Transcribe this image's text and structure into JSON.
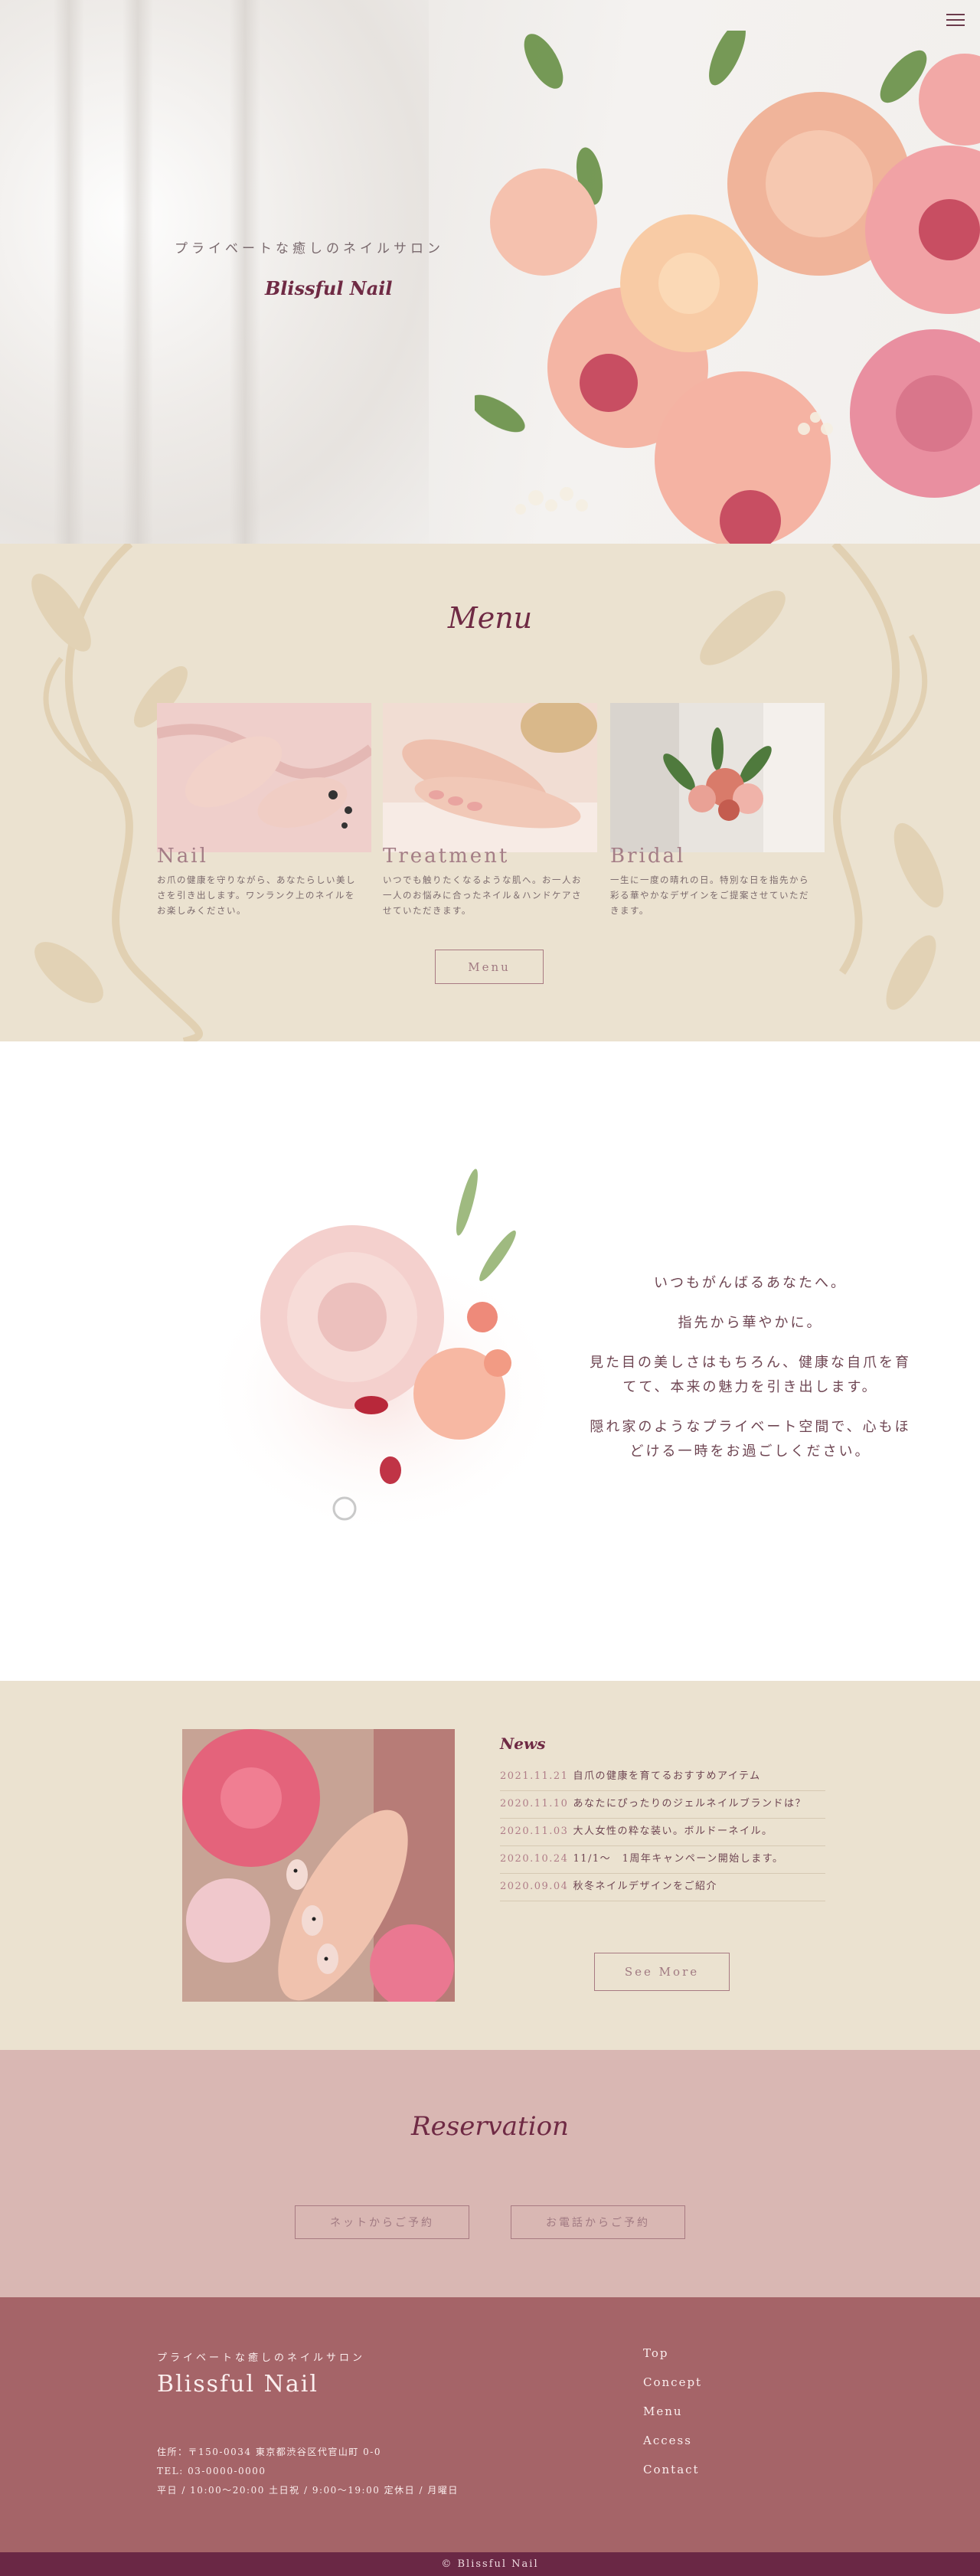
{
  "hero": {
    "subtitle": "プライベートな癒しのネイルサロン",
    "logo": "Blissful Nail"
  },
  "menu": {
    "title": "Menu",
    "cards": [
      {
        "title": "Nail",
        "text": "お爪の健康を守りながら、あなたらしい美しさを引き出します。ワンランク上のネイルをお楽しみください。"
      },
      {
        "title": "Treatment",
        "text": "いつでも触りたくなるような肌へ。お一人お一人のお悩みに合ったネイル＆ハンドケアさせていただきます。"
      },
      {
        "title": "Bridal",
        "text": "一生に一度の晴れの日。特別な日を指先から彩る華やかなデザインをご提案させていただきます。"
      }
    ],
    "button": "Menu"
  },
  "concept": {
    "lines": [
      "いつもがんばるあなたへ。",
      "指先から華やかに。",
      "見た目の美しさはもちろん、健康な自爪を育てて、本来の魅力を引き出します。",
      "隠れ家のようなプライベート空間で、心もほどける一時をお過ごしください。"
    ]
  },
  "news": {
    "title": "News",
    "items": [
      {
        "date": "2021.11.21",
        "text": "自爪の健康を育てるおすすめアイテム"
      },
      {
        "date": "2020.11.10",
        "text": "あなたにぴったりのジェルネイルブランドは？"
      },
      {
        "date": "2020.11.03",
        "text": "大人女性の粋な装い。ボルドーネイル。"
      },
      {
        "date": "2020.10.24",
        "text": "11/1〜　1周年キャンペーン開始します。"
      },
      {
        "date": "2020.09.04",
        "text": "秋冬ネイルデザインをご紹介"
      }
    ],
    "button": "See More"
  },
  "reservation": {
    "title": "Reservation",
    "net_button": "ネットからご予約",
    "phone_button": "お電話からご予約"
  },
  "footer": {
    "subtitle": "プライベートな癒しのネイルサロン",
    "name": "Blissful Nail",
    "address": "住所：〒150-0034 東京都渋谷区代官山町 0-0",
    "tel": "TEL: 03-0000-0000",
    "hours": "平日 / 10:00〜20:00 土日祝 / 9:00〜19:00 定休日 / 月曜日",
    "nav": [
      "Top",
      "Concept",
      "Menu",
      "Access",
      "Contact"
    ],
    "copyright": "© Blissful Nail"
  },
  "colors": {
    "accent": "#6f2a44",
    "beige": "#ebe2d0",
    "pink": "#d9b7b3",
    "footer": "#a56468"
  }
}
